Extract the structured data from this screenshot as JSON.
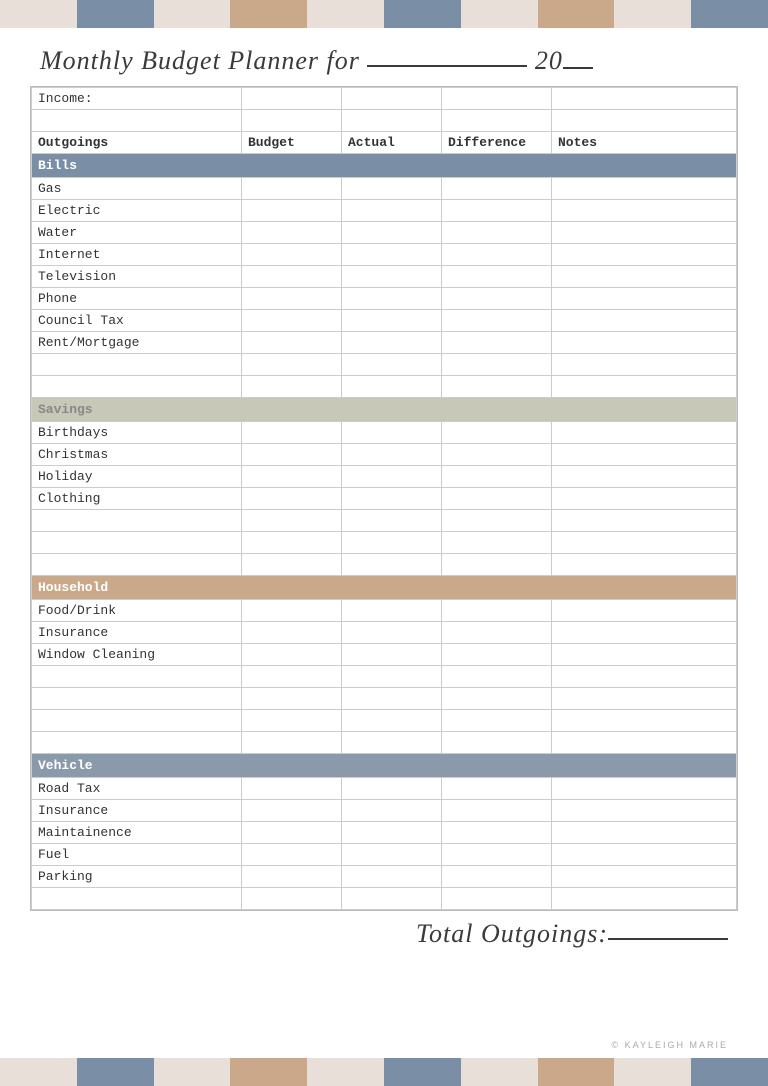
{
  "title": {
    "line1": "Monthly Budget Planner for ",
    "blank1": "___________",
    "year_prefix": " 20",
    "blank2": "__"
  },
  "deco_colors": [
    "#e8e0d8",
    "#7a8fa6",
    "#e8e0d8",
    "#c9a98a",
    "#e8e0d8",
    "#7a8fa6",
    "#e8e0d8",
    "#c9a98a",
    "#e8e0d8",
    "#7a8fa6"
  ],
  "table": {
    "income_label": "Income:",
    "columns": [
      "Outgoings",
      "Budget",
      "Actual",
      "Difference",
      "Notes"
    ],
    "sections": [
      {
        "name": "Bills",
        "color": "bills",
        "rows": [
          "Gas",
          "Electric",
          "Water",
          "Internet",
          "Television",
          "Phone",
          "Council Tax",
          "Rent/Mortgage",
          "",
          ""
        ]
      },
      {
        "name": "Savings",
        "color": "savings",
        "rows": [
          "Birthdays",
          "Christmas",
          "Holiday",
          "Clothing",
          "",
          "",
          ""
        ]
      },
      {
        "name": "Household",
        "color": "household",
        "rows": [
          "Food/Drink",
          "Insurance",
          "Window Cleaning",
          "",
          "",
          "",
          ""
        ]
      },
      {
        "name": "Vehicle",
        "color": "vehicle",
        "rows": [
          "Road Tax",
          "Insurance",
          "Maintainence",
          "Fuel",
          "Parking",
          ""
        ]
      }
    ]
  },
  "footer": {
    "total_label": "Total Outgoings:",
    "total_blank": "_______",
    "copyright": "© KAYLEIGH MARIE"
  }
}
